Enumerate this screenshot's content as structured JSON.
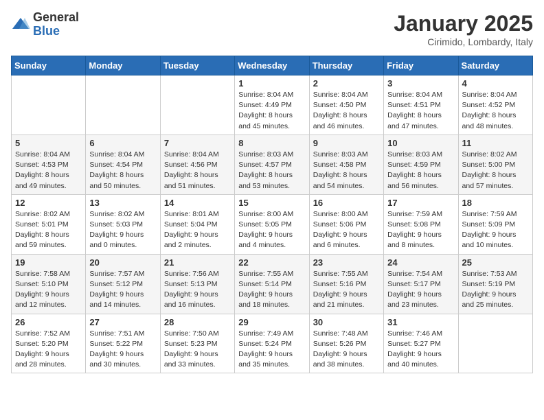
{
  "logo": {
    "general": "General",
    "blue": "Blue"
  },
  "header": {
    "month": "January 2025",
    "location": "Cirimido, Lombardy, Italy"
  },
  "days_of_week": [
    "Sunday",
    "Monday",
    "Tuesday",
    "Wednesday",
    "Thursday",
    "Friday",
    "Saturday"
  ],
  "weeks": [
    [
      {
        "day": "",
        "info": ""
      },
      {
        "day": "",
        "info": ""
      },
      {
        "day": "",
        "info": ""
      },
      {
        "day": "1",
        "info": "Sunrise: 8:04 AM\nSunset: 4:49 PM\nDaylight: 8 hours\nand 45 minutes."
      },
      {
        "day": "2",
        "info": "Sunrise: 8:04 AM\nSunset: 4:50 PM\nDaylight: 8 hours\nand 46 minutes."
      },
      {
        "day": "3",
        "info": "Sunrise: 8:04 AM\nSunset: 4:51 PM\nDaylight: 8 hours\nand 47 minutes."
      },
      {
        "day": "4",
        "info": "Sunrise: 8:04 AM\nSunset: 4:52 PM\nDaylight: 8 hours\nand 48 minutes."
      }
    ],
    [
      {
        "day": "5",
        "info": "Sunrise: 8:04 AM\nSunset: 4:53 PM\nDaylight: 8 hours\nand 49 minutes."
      },
      {
        "day": "6",
        "info": "Sunrise: 8:04 AM\nSunset: 4:54 PM\nDaylight: 8 hours\nand 50 minutes."
      },
      {
        "day": "7",
        "info": "Sunrise: 8:04 AM\nSunset: 4:56 PM\nDaylight: 8 hours\nand 51 minutes."
      },
      {
        "day": "8",
        "info": "Sunrise: 8:03 AM\nSunset: 4:57 PM\nDaylight: 8 hours\nand 53 minutes."
      },
      {
        "day": "9",
        "info": "Sunrise: 8:03 AM\nSunset: 4:58 PM\nDaylight: 8 hours\nand 54 minutes."
      },
      {
        "day": "10",
        "info": "Sunrise: 8:03 AM\nSunset: 4:59 PM\nDaylight: 8 hours\nand 56 minutes."
      },
      {
        "day": "11",
        "info": "Sunrise: 8:02 AM\nSunset: 5:00 PM\nDaylight: 8 hours\nand 57 minutes."
      }
    ],
    [
      {
        "day": "12",
        "info": "Sunrise: 8:02 AM\nSunset: 5:01 PM\nDaylight: 8 hours\nand 59 minutes."
      },
      {
        "day": "13",
        "info": "Sunrise: 8:02 AM\nSunset: 5:03 PM\nDaylight: 9 hours\nand 0 minutes."
      },
      {
        "day": "14",
        "info": "Sunrise: 8:01 AM\nSunset: 5:04 PM\nDaylight: 9 hours\nand 2 minutes."
      },
      {
        "day": "15",
        "info": "Sunrise: 8:00 AM\nSunset: 5:05 PM\nDaylight: 9 hours\nand 4 minutes."
      },
      {
        "day": "16",
        "info": "Sunrise: 8:00 AM\nSunset: 5:06 PM\nDaylight: 9 hours\nand 6 minutes."
      },
      {
        "day": "17",
        "info": "Sunrise: 7:59 AM\nSunset: 5:08 PM\nDaylight: 9 hours\nand 8 minutes."
      },
      {
        "day": "18",
        "info": "Sunrise: 7:59 AM\nSunset: 5:09 PM\nDaylight: 9 hours\nand 10 minutes."
      }
    ],
    [
      {
        "day": "19",
        "info": "Sunrise: 7:58 AM\nSunset: 5:10 PM\nDaylight: 9 hours\nand 12 minutes."
      },
      {
        "day": "20",
        "info": "Sunrise: 7:57 AM\nSunset: 5:12 PM\nDaylight: 9 hours\nand 14 minutes."
      },
      {
        "day": "21",
        "info": "Sunrise: 7:56 AM\nSunset: 5:13 PM\nDaylight: 9 hours\nand 16 minutes."
      },
      {
        "day": "22",
        "info": "Sunrise: 7:55 AM\nSunset: 5:14 PM\nDaylight: 9 hours\nand 18 minutes."
      },
      {
        "day": "23",
        "info": "Sunrise: 7:55 AM\nSunset: 5:16 PM\nDaylight: 9 hours\nand 21 minutes."
      },
      {
        "day": "24",
        "info": "Sunrise: 7:54 AM\nSunset: 5:17 PM\nDaylight: 9 hours\nand 23 minutes."
      },
      {
        "day": "25",
        "info": "Sunrise: 7:53 AM\nSunset: 5:19 PM\nDaylight: 9 hours\nand 25 minutes."
      }
    ],
    [
      {
        "day": "26",
        "info": "Sunrise: 7:52 AM\nSunset: 5:20 PM\nDaylight: 9 hours\nand 28 minutes."
      },
      {
        "day": "27",
        "info": "Sunrise: 7:51 AM\nSunset: 5:22 PM\nDaylight: 9 hours\nand 30 minutes."
      },
      {
        "day": "28",
        "info": "Sunrise: 7:50 AM\nSunset: 5:23 PM\nDaylight: 9 hours\nand 33 minutes."
      },
      {
        "day": "29",
        "info": "Sunrise: 7:49 AM\nSunset: 5:24 PM\nDaylight: 9 hours\nand 35 minutes."
      },
      {
        "day": "30",
        "info": "Sunrise: 7:48 AM\nSunset: 5:26 PM\nDaylight: 9 hours\nand 38 minutes."
      },
      {
        "day": "31",
        "info": "Sunrise: 7:46 AM\nSunset: 5:27 PM\nDaylight: 9 hours\nand 40 minutes."
      },
      {
        "day": "",
        "info": ""
      }
    ]
  ]
}
